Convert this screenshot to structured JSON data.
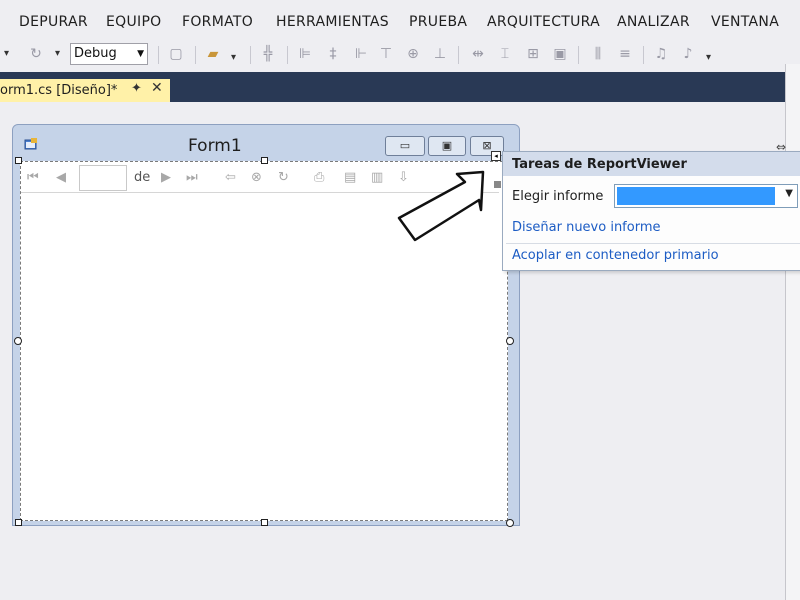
{
  "menu": {
    "items": [
      "DEPURAR",
      "EQUIPO",
      "FORMATO",
      "HERRAMIENTAS",
      "PRUEBA",
      "ARQUITECTURA",
      "ANALIZAR",
      "VENTANA"
    ]
  },
  "toolbar": {
    "config_value": "Debug"
  },
  "document_tab": {
    "label": "orm1.cs [Diseño]*",
    "pin_glyph": "✦",
    "close_glyph": "✕"
  },
  "form": {
    "title": "Form1"
  },
  "report_viewer": {
    "of_label": "de"
  },
  "tasks_panel": {
    "title": "Tareas de ReportViewer",
    "choose_report_label": "Elegir informe",
    "design_new_report_link": "Diseñar nuevo informe",
    "dock_link": "Acoplar en contenedor primario"
  },
  "colors": {
    "tab_strip": "#293955",
    "active_tab": "#fff1a8",
    "selection": "#3399ff",
    "link": "#1c5cc4"
  }
}
